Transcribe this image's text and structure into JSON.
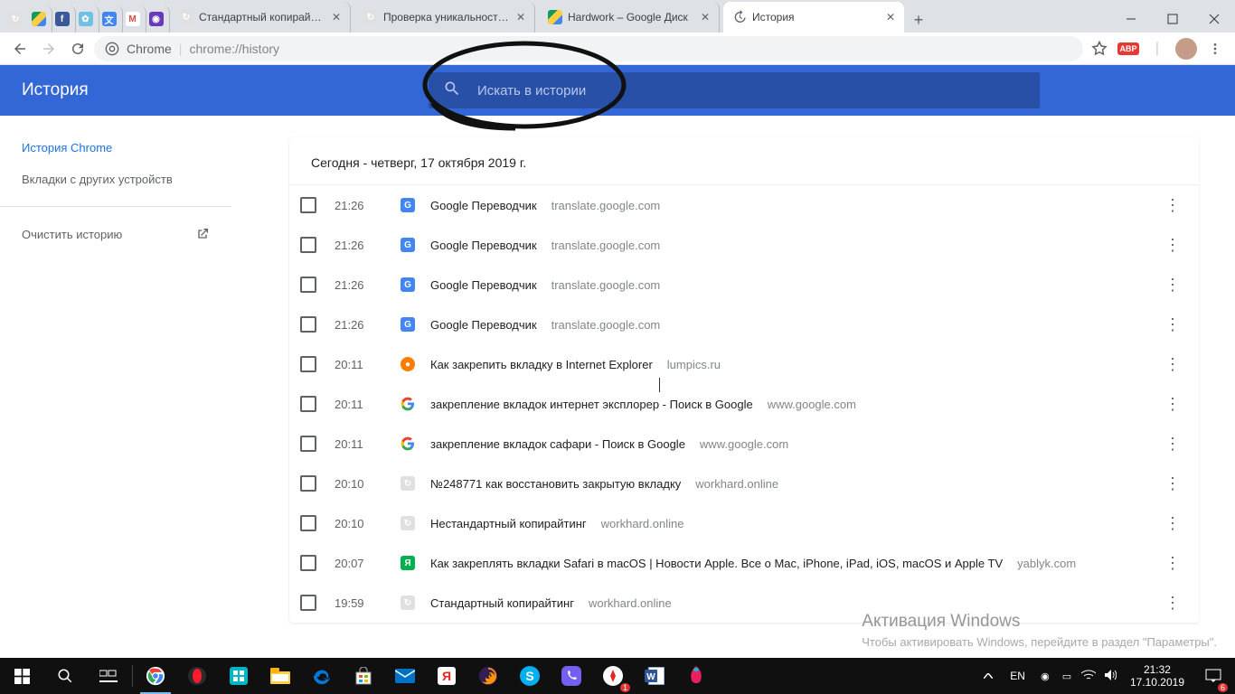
{
  "browser_tabs": {
    "mini": [
      {
        "name": "drive-icon"
      },
      {
        "name": "facebook-icon"
      },
      {
        "name": "settings-icon"
      },
      {
        "name": "translate-icon"
      },
      {
        "name": "gmail-icon"
      },
      {
        "name": "app-icon"
      }
    ],
    "open": [
      {
        "title": "Стандартный копирайтинг",
        "fav": "grey"
      },
      {
        "title": "Проверка уникальности дл",
        "fav": "grey"
      },
      {
        "title": "Hardwork – Google Диск",
        "fav": "drive"
      }
    ],
    "active": {
      "title": "История",
      "fav": "history"
    }
  },
  "omnibox": {
    "chrome_label": "Chrome",
    "path": "chrome://history"
  },
  "header": {
    "title": "История",
    "search_placeholder": "Искать в истории"
  },
  "sidebar": {
    "item1": "История Chrome",
    "item2": "Вкладки с других устройств",
    "item3": "Очистить историю"
  },
  "date_heading": "Сегодня - четверг, 17 октября 2019 г.",
  "history": [
    {
      "time": "21:26",
      "title": "Google Переводчик",
      "domain": "translate.google.com",
      "fav": "blue"
    },
    {
      "time": "21:26",
      "title": "Google Переводчик",
      "domain": "translate.google.com",
      "fav": "blue"
    },
    {
      "time": "21:26",
      "title": "Google Переводчик",
      "domain": "translate.google.com",
      "fav": "blue"
    },
    {
      "time": "21:26",
      "title": "Google Переводчик",
      "domain": "translate.google.com",
      "fav": "blue"
    },
    {
      "time": "20:11",
      "title": "Как закрепить вкладку в Internet Explorer",
      "domain": "lumpics.ru",
      "fav": "orange"
    },
    {
      "time": "20:11",
      "title": "закрепление вкладок интернет эксплорер - Поиск в Google",
      "domain": "www.google.com",
      "fav": "google"
    },
    {
      "time": "20:11",
      "title": "закрепление вкладок сафари - Поиск в Google",
      "domain": "www.google.com",
      "fav": "google"
    },
    {
      "time": "20:10",
      "title": "№248771 как восстановить закрытую вкладку",
      "domain": "workhard.online",
      "fav": "grey"
    },
    {
      "time": "20:10",
      "title": "Нестандартный копирайтинг",
      "domain": "workhard.online",
      "fav": "grey"
    },
    {
      "time": "20:07",
      "title": "Как закреплять вкладки Safari в macOS | Новости Apple. Все о Mac, iPhone, iPad, iOS, macOS и Apple TV",
      "domain": "yablyk.com",
      "fav": "green"
    },
    {
      "time": "19:59",
      "title": "Стандартный копирайтинг",
      "domain": "workhard.online",
      "fav": "grey"
    }
  ],
  "watermark": {
    "title": "Активация Windows",
    "line": "Чтобы активировать Windows, перейдите в раздел \"Параметры\"."
  },
  "taskbar": {
    "lang": "EN",
    "time": "21:32",
    "date": "17.10.2019"
  }
}
